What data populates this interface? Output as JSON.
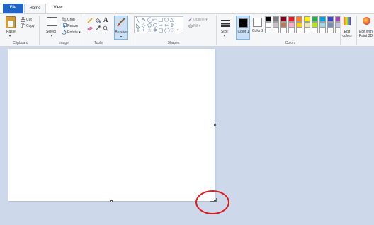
{
  "tabs": {
    "file": "File",
    "home": "Home",
    "view": "View"
  },
  "clipboard": {
    "paste": "Paste",
    "cut": "Cut",
    "copy": "Copy",
    "label": "Clipboard"
  },
  "image": {
    "select": "Select",
    "crop": "Crop",
    "resize": "Resize",
    "rotate": "Rotate",
    "label": "Image"
  },
  "tools": {
    "label": "Tools",
    "text_tool": "A"
  },
  "brushes": {
    "label": "Brushes"
  },
  "shapes": {
    "label": "Shapes",
    "outline": "Outline",
    "fill": "Fill"
  },
  "size": {
    "label": "Size"
  },
  "colors": {
    "color1": "Color 1",
    "color2": "Color 2",
    "edit_colors": "Edit colors",
    "edit_with_paint3d": "Edit with Paint 3D",
    "label": "Colors",
    "palette_row1": [
      "#000000",
      "#7f7f7f",
      "#880015",
      "#ed1c24",
      "#ff7f27",
      "#fff200",
      "#22b14c",
      "#00a2e8",
      "#3f48cc",
      "#a349a4"
    ],
    "palette_row2": [
      "#ffffff",
      "#c3c3c3",
      "#b97a57",
      "#ffaec9",
      "#ffc90e",
      "#efe4b0",
      "#b5e61d",
      "#99d9ea",
      "#7092be",
      "#c8bfe7"
    ],
    "palette_row3": [
      "#ffffff",
      "#ffffff",
      "#ffffff",
      "#ffffff",
      "#ffffff",
      "#ffffff",
      "#ffffff",
      "#ffffff",
      "#ffffff",
      "#ffffff"
    ]
  }
}
